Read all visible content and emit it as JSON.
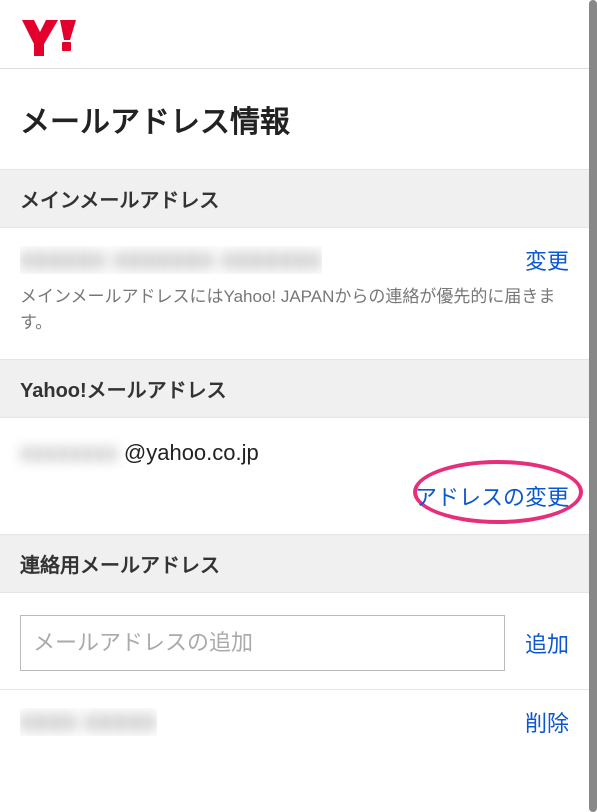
{
  "brand": {
    "logo_color": "#e3002d"
  },
  "page": {
    "title": "メールアドレス情報"
  },
  "sections": {
    "main_email": {
      "header": "メインメールアドレス",
      "value_masked": "xxxxxx xxxxxxx xxxxxxx",
      "change_label": "変更",
      "hint": "メインメールアドレスにはYahoo! JAPANからの連絡が優先的に届きます。"
    },
    "yahoo_email": {
      "header": "Yahoo!メールアドレス",
      "local_masked": "xxxxxxxx",
      "domain": "@yahoo.co.jp",
      "change_label": "アドレスの変更"
    },
    "contact_email": {
      "header": "連絡用メールアドレス",
      "input_placeholder": "メールアドレスの追加",
      "add_label": "追加",
      "existing_masked": "xxxx xxxxx",
      "delete_label": "削除"
    }
  }
}
